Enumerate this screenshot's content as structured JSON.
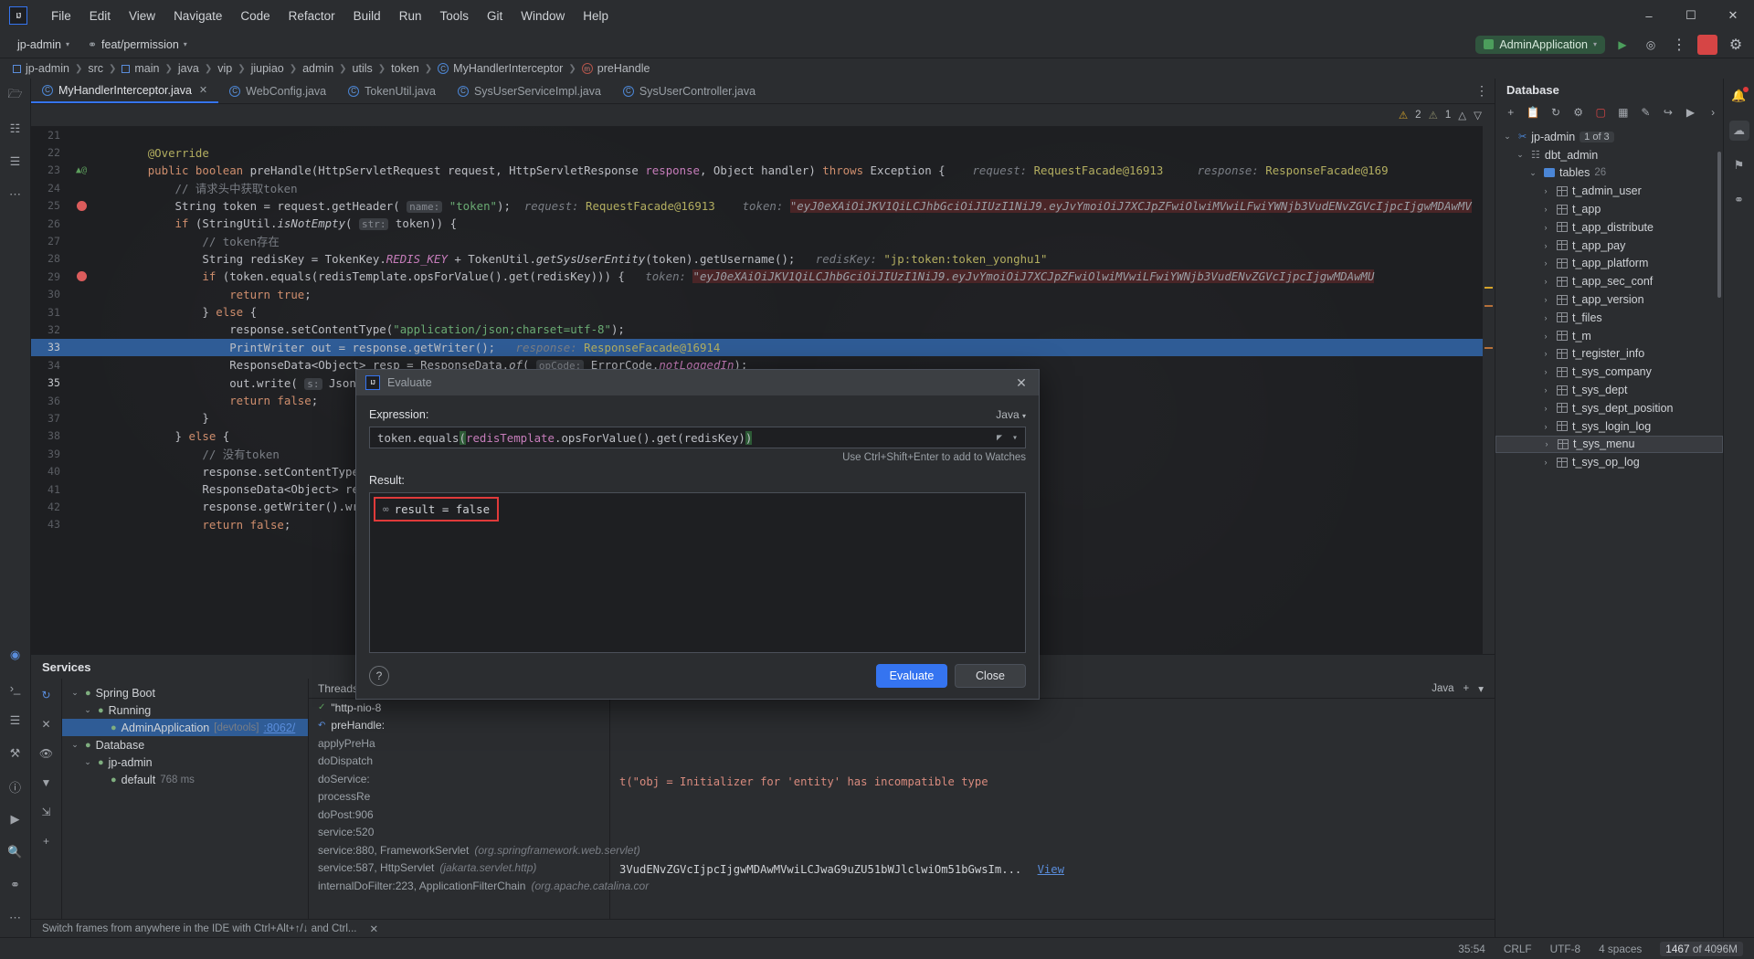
{
  "menubar": {
    "logo": "IJ",
    "items": [
      "File",
      "Edit",
      "View",
      "Navigate",
      "Code",
      "Refactor",
      "Build",
      "Run",
      "Tools",
      "Git",
      "Window",
      "Help"
    ],
    "window_controls": [
      "–",
      "☐",
      "✕"
    ]
  },
  "toolbar": {
    "project": "jp-admin",
    "branch": "feat/permission",
    "run_config": "AdminApplication",
    "icons": [
      "run-icon",
      "debug-icon",
      "more-actions-icon",
      "stop-icon",
      "settings-icon"
    ]
  },
  "breadcrumbs": [
    {
      "label": "jp-admin",
      "icon": "module-icon"
    },
    {
      "label": "src",
      "icon": ""
    },
    {
      "label": "main",
      "icon": "module-icon"
    },
    {
      "label": "java",
      "icon": ""
    },
    {
      "label": "vip",
      "icon": ""
    },
    {
      "label": "jiupiao",
      "icon": ""
    },
    {
      "label": "admin",
      "icon": ""
    },
    {
      "label": "utils",
      "icon": ""
    },
    {
      "label": "token",
      "icon": ""
    },
    {
      "label": "MyHandlerInterceptor",
      "icon": "class-icon"
    },
    {
      "label": "preHandle",
      "icon": "method-icon"
    }
  ],
  "editor_tabs": [
    {
      "label": "MyHandlerInterceptor.java",
      "active": true,
      "closable": true
    },
    {
      "label": "WebConfig.java",
      "active": false,
      "closable": false
    },
    {
      "label": "TokenUtil.java",
      "active": false,
      "closable": false
    },
    {
      "label": "SysUserServiceImpl.java",
      "active": false,
      "closable": false
    },
    {
      "label": "SysUserController.java",
      "active": false,
      "closable": false
    }
  ],
  "inspections": {
    "warnings": "2",
    "weak_warnings": "1"
  },
  "code_lines": [
    {
      "num": "21",
      "html": ""
    },
    {
      "num": "22",
      "html": "        <span class='ann'>@Override</span>"
    },
    {
      "num": "23",
      "html": "        <span class='kw'>public boolean</span> <span class='mth'>preHandle</span>(<span class='mth'>HttpServletRequest</span> request, <span class='mth'>HttpServletResponse</span> <span class='fld'>response</span>, <span class='mth'>Object</span> handler) <span class='kw'>throws</span> <span class='mth'>Exception</span> {    <span class='hint'>request:</span> <span class='ann'>RequestFacade@16913</span>     <span class='hint'>response:</span> <span class='ann'>ResponseFacade@169</span>"
    },
    {
      "num": "24",
      "html": "            <span class='cmt'>// 请求头中获取token</span>"
    },
    {
      "num": "25",
      "html": "            <span class='mth'>String</span> token = request.getHeader( <span class='param-hint'>name:</span> <span class='str'>\"token\"</span>);  <span class='hint'>request:</span> <span class='ann'>RequestFacade@16913</span>    <span class='hint'>token:</span> <span class='errstr'>\"eyJ0eXAiOiJKV1QiLCJhbGciOiJIUzI1NiJ9.eyJvYmoiOiJ7XCJpZFwiOlwiMVwiLFwiYWNjb3VudENvZGVcIjpcIjgwMDAwMV</span>"
    },
    {
      "num": "26",
      "html": "            <span class='kw'>if</span> (StringUtil.<span class='smth'>isNotEmpty</span>( <span class='param-hint'>str:</span> token)) {"
    },
    {
      "num": "27",
      "html": "                <span class='cmt'>// token存在</span>"
    },
    {
      "num": "28",
      "html": "                <span class='mth'>String</span> redisKey = TokenKey.<span class='sfld'>REDIS_KEY</span> + TokenUtil.<span class='smth'>getSysUserEntity</span>(token).getUsername();   <span class='hint'>redisKey:</span> <span class='ann'>\"jp:token:token_yonghu1\"</span>"
    },
    {
      "num": "29",
      "html": "                <span class='kw'>if</span> (token.equals(redisTemplate.opsForValue().get(redisKey))) {   <span class='hint'>token:</span> <span class='errstr'>\"eyJ0eXAiOiJKV1QiLCJhbGciOiJIUzI1NiJ9.eyJvYmoiOiJ7XCJpZFwiOlwiMVwiLFwiYWNjb3VudENvZGVcIjpcIjgwMDAwMU</span>"
    },
    {
      "num": "30",
      "html": "                    <span class='kw'>return true</span>;"
    },
    {
      "num": "31",
      "html": "                } <span class='kw'>else</span> {"
    },
    {
      "num": "32",
      "html": "                    response.setContentType(<span class='str'>\"application/json;charset=utf-8\"</span>);"
    },
    {
      "num": "33",
      "html": "                    <span class='mth'>PrintWriter</span> out = response.getWriter();   <span class='hint'>response:</span> <span class='ann'>ResponseFacade@16914</span>",
      "selected": true
    },
    {
      "num": "34",
      "html": "                    <span class='mth'>ResponseData</span>&lt;Object&gt; resp = ResponseData.<span class='smth'>of</span>( <span class='param-hint'>opCode:</span> ErrorCode.<span class='sfld'>notLoggedIn</span>);"
    },
    {
      "num": "35",
      "html": "                    out.write( <span class='param-hint'>s:</span> JsonUtil.<span class='smth'>writeValue</span>( <span class='param-hint'>object:</span> resp));",
      "current": true
    },
    {
      "num": "36",
      "html": "                    <span class='kw'>return false</span>;"
    },
    {
      "num": "37",
      "html": "                }"
    },
    {
      "num": "38",
      "html": "            } <span class='kw'>else</span> {"
    },
    {
      "num": "39",
      "html": "                <span class='cmt'>// 没有token</span>"
    },
    {
      "num": "40",
      "html": "                response.setContentType(<span class='str'>\"applica</span>"
    },
    {
      "num": "41",
      "html": "                <span class='mth'>ResponseData</span>&lt;Object&gt; resp = Resp"
    },
    {
      "num": "42",
      "html": "                response.getWriter().write( <span class='param-hint'>s:</span> Js"
    },
    {
      "num": "43",
      "html": "                <span class='kw'>return false</span>;"
    }
  ],
  "services": {
    "title": "Services",
    "tree": [
      {
        "label": "Spring Boot",
        "indent": 0,
        "arrow": "⌄",
        "icon": "spring-icon"
      },
      {
        "label": "Running",
        "indent": 1,
        "arrow": "⌄",
        "icon": "run-icon"
      },
      {
        "label": "AdminApplication",
        "indent": 2,
        "arrow": "",
        "icon": "app-icon",
        "sub": "[devtools]",
        "link": ":8062/"
      },
      {
        "label": "Database",
        "indent": 0,
        "arrow": "⌄",
        "icon": "db-icon"
      },
      {
        "label": "jp-admin",
        "indent": 1,
        "arrow": "⌄",
        "icon": "conn-icon"
      },
      {
        "label": "default",
        "indent": 2,
        "arrow": "",
        "icon": "schema-icon",
        "sub": "768 ms"
      }
    ],
    "frames_header": "Threads & Vari",
    "frames": [
      {
        "label": "\"http-nio-8",
        "type": "thread"
      },
      {
        "label": "preHandle:",
        "type": "current"
      },
      {
        "label": "applyPreHa",
        "type": "frame"
      },
      {
        "label": "doDispatch",
        "type": "frame"
      },
      {
        "label": "doService:",
        "type": "frame"
      },
      {
        "label": "processRe",
        "type": "frame"
      },
      {
        "label": "doPost:906",
        "type": "frame"
      },
      {
        "label": "service:520",
        "type": "frame"
      },
      {
        "label": "service:880, FrameworkServlet",
        "sub": "(org.springframework.web.servlet)",
        "type": "frame"
      },
      {
        "label": "service:587, HttpServlet",
        "sub": "(jakarta.servlet.http)",
        "type": "frame"
      },
      {
        "label": "internalDoFilter:223, ApplicationFilterChain",
        "sub": "(org.apache.catalina.cor",
        "type": "frame"
      }
    ],
    "variables_lang": "Java",
    "variable_error": "t(\"obj = Initializer for 'entity' has incompatible type",
    "variable_token": "3VudENvZGVcIjpcIjgwMDAwMVwiLCJwaG9uZU51bWJlclwiOm51bGwsIm...",
    "view_link": "View",
    "hint": "Switch frames from anywhere in the IDE with Ctrl+Alt+↑/↓ and Ctrl..."
  },
  "database": {
    "title": "Database",
    "toolbar_icons": [
      "add-icon",
      "copy-icon",
      "refresh-icon",
      "settings-icon",
      "filter-icon",
      "table-icon",
      "edit-icon",
      "jump-icon",
      "run-icon",
      "more-icon"
    ],
    "tree": [
      {
        "label": "jp-admin",
        "badge": "1 of 3",
        "indent": 0,
        "arrow": "⌄",
        "icon": "connection-icon"
      },
      {
        "label": "dbt_admin",
        "indent": 1,
        "arrow": "⌄",
        "icon": "schema-icon"
      },
      {
        "label": "tables",
        "count": "26",
        "indent": 2,
        "arrow": "⌄",
        "icon": "folder-icon"
      },
      {
        "label": "t_admin_user",
        "indent": 3,
        "arrow": "›",
        "icon": "table-icon"
      },
      {
        "label": "t_app",
        "indent": 3,
        "arrow": "›",
        "icon": "table-icon"
      },
      {
        "label": "t_app_distribute",
        "indent": 3,
        "arrow": "›",
        "icon": "table-icon"
      },
      {
        "label": "t_app_pay",
        "indent": 3,
        "arrow": "›",
        "icon": "table-icon"
      },
      {
        "label": "t_app_platform",
        "indent": 3,
        "arrow": "›",
        "icon": "table-icon"
      },
      {
        "label": "t_app_sec_conf",
        "indent": 3,
        "arrow": "›",
        "icon": "table-icon"
      },
      {
        "label": "t_app_version",
        "indent": 3,
        "arrow": "›",
        "icon": "table-icon"
      },
      {
        "label": "t_files",
        "indent": 3,
        "arrow": "›",
        "icon": "table-icon"
      },
      {
        "label": "t_m",
        "indent": 3,
        "arrow": "›",
        "icon": "table-icon"
      },
      {
        "label": "t_register_info",
        "indent": 3,
        "arrow": "›",
        "icon": "table-icon"
      },
      {
        "label": "t_sys_company",
        "indent": 3,
        "arrow": "›",
        "icon": "table-icon"
      },
      {
        "label": "t_sys_dept",
        "indent": 3,
        "arrow": "›",
        "icon": "table-icon"
      },
      {
        "label": "t_sys_dept_position",
        "indent": 3,
        "arrow": "›",
        "icon": "table-icon"
      },
      {
        "label": "t_sys_login_log",
        "indent": 3,
        "arrow": "›",
        "icon": "table-icon"
      },
      {
        "label": "t_sys_menu",
        "indent": 3,
        "arrow": "›",
        "icon": "table-icon",
        "selected": true
      },
      {
        "label": "t_sys_op_log",
        "indent": 3,
        "arrow": "›",
        "icon": "table-icon"
      }
    ]
  },
  "dialog": {
    "title": "Evaluate",
    "expression_label": "Expression:",
    "language": "Java",
    "expression_value": "token.equals(redisTemplate.opsForValue().get(redisKey))",
    "watch_hint": "Use Ctrl+Shift+Enter to add to Watches",
    "result_label": "Result:",
    "result_value": "result = false",
    "evaluate_button": "Evaluate",
    "close_button": "Close",
    "help_button": "?"
  },
  "statusbar": {
    "position": "35:54",
    "line_sep": "CRLF",
    "encoding": "UTF-8",
    "indent": "4 spaces",
    "memory_used": "1467",
    "memory_total": "of 4096M"
  },
  "colors": {
    "accent": "#3574f0",
    "selection": "#2f5c96",
    "error": "#e03a3a",
    "run_green": "#30553e",
    "warning": "#d4a32a"
  }
}
